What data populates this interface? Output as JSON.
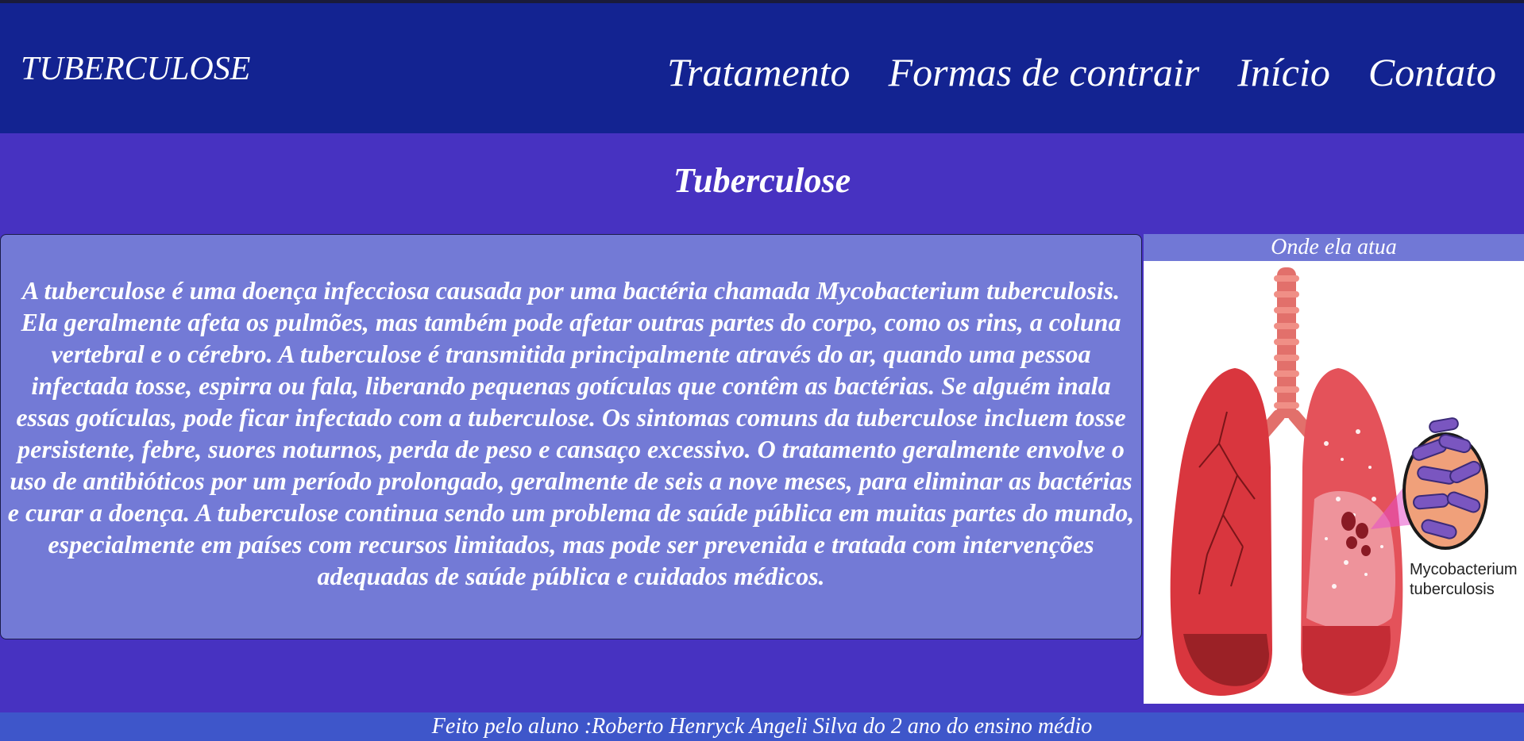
{
  "header": {
    "brand": "TUBERCULOSE",
    "nav": [
      {
        "label": "Tratamento"
      },
      {
        "label": "Formas de contrair"
      },
      {
        "label": "Início"
      },
      {
        "label": "Contato"
      }
    ]
  },
  "main": {
    "title": "Tuberculose",
    "description": "A tuberculose é uma doença infecciosa causada por uma bactéria chamada Mycobacterium tuberculosis. Ela geralmente afeta os pulmões, mas também pode afetar outras partes do corpo, como os rins, a coluna vertebral e o cérebro. A tuberculose é transmitida principalmente através do ar, quando uma pessoa infectada tosse, espirra ou fala, liberando pequenas gotículas que contêm as bactérias. Se alguém inala essas gotículas, pode ficar infectado com a tuberculose. Os sintomas comuns da tuberculose incluem tosse persistente, febre, suores noturnos, perda de peso e cansaço excessivo. O tratamento geralmente envolve o uso de antibióticos por um período prolongado, geralmente de seis a nove meses, para eliminar as bactérias e curar a doença. A tuberculose continua sendo um problema de saúde pública em muitas partes do mundo, especialmente em países com recursos limitados, mas pode ser prevenida e tratada com intervenções adequadas de saúde pública e cuidados médicos."
  },
  "aside": {
    "caption": "Onde ela atua",
    "figure_label_line1": "Mycobacterium",
    "figure_label_line2": "tuberculosis"
  },
  "footer": {
    "text": "Feito pelo aluno :Roberto Henryck Angeli Silva do 2 ano do ensino médio"
  },
  "colors": {
    "header_bg": "#132391",
    "page_bg": "#4732c1",
    "card_bg": "#737ad6",
    "footer_bg": "#3e56ca"
  }
}
